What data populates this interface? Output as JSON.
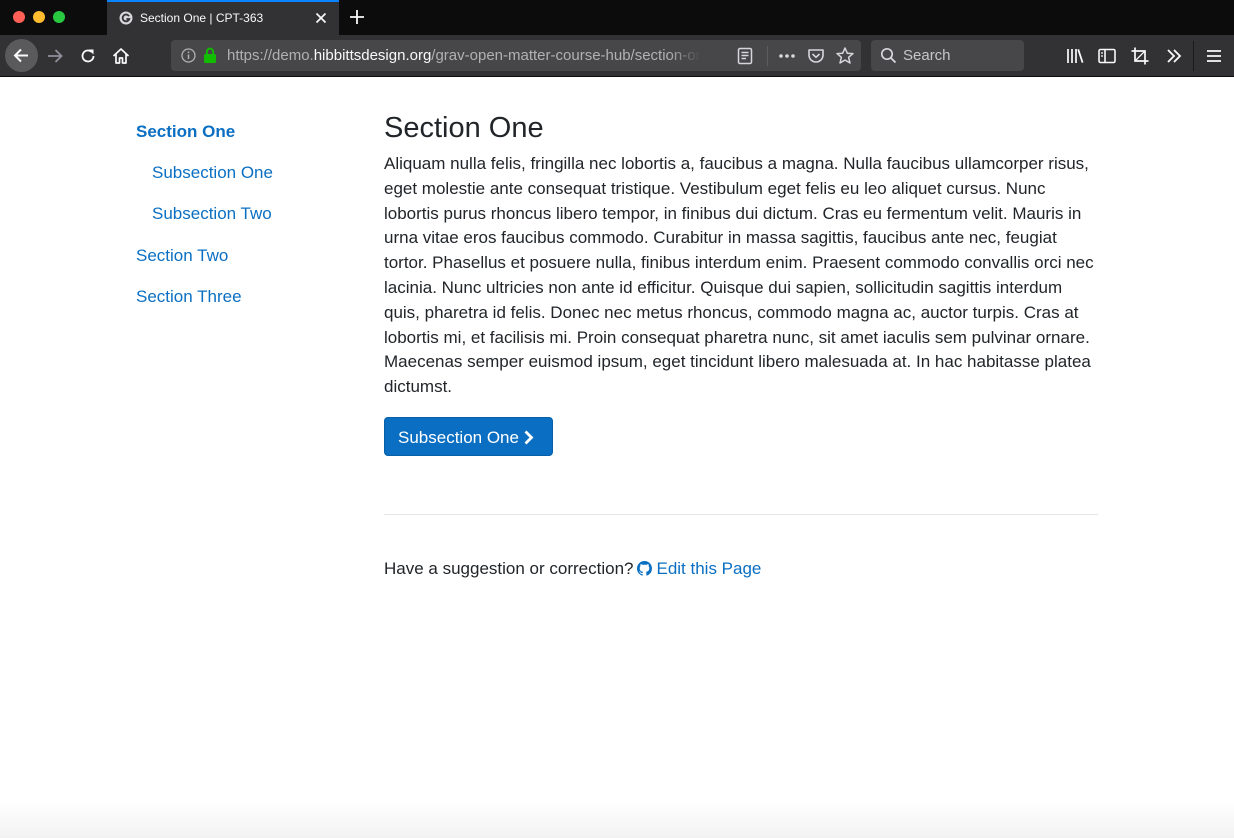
{
  "browser": {
    "tab": {
      "title": "Section One | CPT-363",
      "favicon": "grav-g-icon"
    },
    "url": {
      "prefix": "https://demo.",
      "domain": "hibbittsdesign.org",
      "path": "/grav-open-matter-course-hub/section-one"
    },
    "search": {
      "placeholder": "Search"
    }
  },
  "sidebar": {
    "items": [
      {
        "label": "Section One",
        "active": true
      },
      {
        "label": "Subsection One"
      },
      {
        "label": "Subsection Two"
      },
      {
        "label": "Section Two"
      },
      {
        "label": "Section Three"
      }
    ]
  },
  "content": {
    "title": "Section One",
    "body": "Aliquam nulla felis, fringilla nec lobortis a, faucibus a magna. Nulla faucibus ullamcorper risus, eget molestie ante consequat tristique. Vestibulum eget felis eu leo aliquet cursus. Nunc lobortis purus rhoncus libero tempor, in finibus dui dictum. Cras eu fermentum velit. Mauris in urna vitae eros faucibus commodo. Curabitur in massa sagittis, faucibus ante nec, feugiat tortor. Phasellus et posuere nulla, finibus interdum enim. Praesent commodo convallis orci nec lacinia. Nunc ultricies non ante id efficitur. Quisque dui sapien, sollicitudin sagittis interdum quis, pharetra id felis. Donec nec metus rhoncus, commodo magna ac, auctor turpis. Cras at lobortis mi, et facilisis mi. Proin consequat pharetra nunc, sit amet iaculis sem pulvinar ornare. Maecenas semper euismod ipsum, eget tincidunt libero malesuada at. In hac habitasse platea dictumst.",
    "next_button": "Subsection One"
  },
  "footer": {
    "suggestion_text": "Have a suggestion or correction?",
    "edit_link": "Edit this Page"
  },
  "colors": {
    "link": "#0a6fc2",
    "text": "#212529",
    "chrome_dark": "#0c0c0d",
    "chrome": "#323234",
    "tab_accent": "#0a84ff"
  }
}
